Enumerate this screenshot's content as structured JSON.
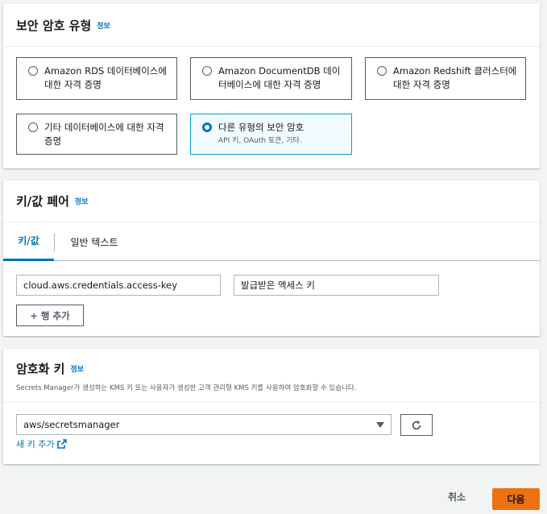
{
  "secret_type": {
    "title": "보안 암호 유형",
    "info": "정보",
    "options": [
      {
        "label": "Amazon RDS 데이터베이스에 대한 자격 증명",
        "sub": ""
      },
      {
        "label": "Amazon DocumentDB 데이터베이스에 대한 자격 증명",
        "sub": ""
      },
      {
        "label": "Amazon Redshift 클러스터에 대한 자격 증명",
        "sub": ""
      },
      {
        "label": "기타 데이터베이스에 대한 자격 증명",
        "sub": ""
      },
      {
        "label": "다른 유형의 보안 암호",
        "sub": "API 키, OAuth 토큰, 기타."
      }
    ],
    "selected_index": 4
  },
  "kv": {
    "title": "키/값 페어",
    "info": "정보",
    "tabs": [
      "키/값",
      "일반 텍스트"
    ],
    "active_tab": 0,
    "key_value": "cloud.aws.credentials.access-key",
    "value_value": "발급받은 액세스 키",
    "add_row": "+ 행 추가"
  },
  "encryption": {
    "title": "암호화 키",
    "info": "정보",
    "description": "Secrets Manager가 생성하는 KMS 키 또는 사용자가 생성한 고객 관리형 KMS 키를 사용하여 암호화할 수 있습니다.",
    "selected_key": "aws/secretsmanager",
    "new_key_link": "새 키 추가"
  },
  "footer": {
    "cancel": "취소",
    "next": "다음"
  },
  "colors": {
    "accent": "#0073bb",
    "primary_button": "#ec7211",
    "selected_border": "#00a1c9"
  }
}
